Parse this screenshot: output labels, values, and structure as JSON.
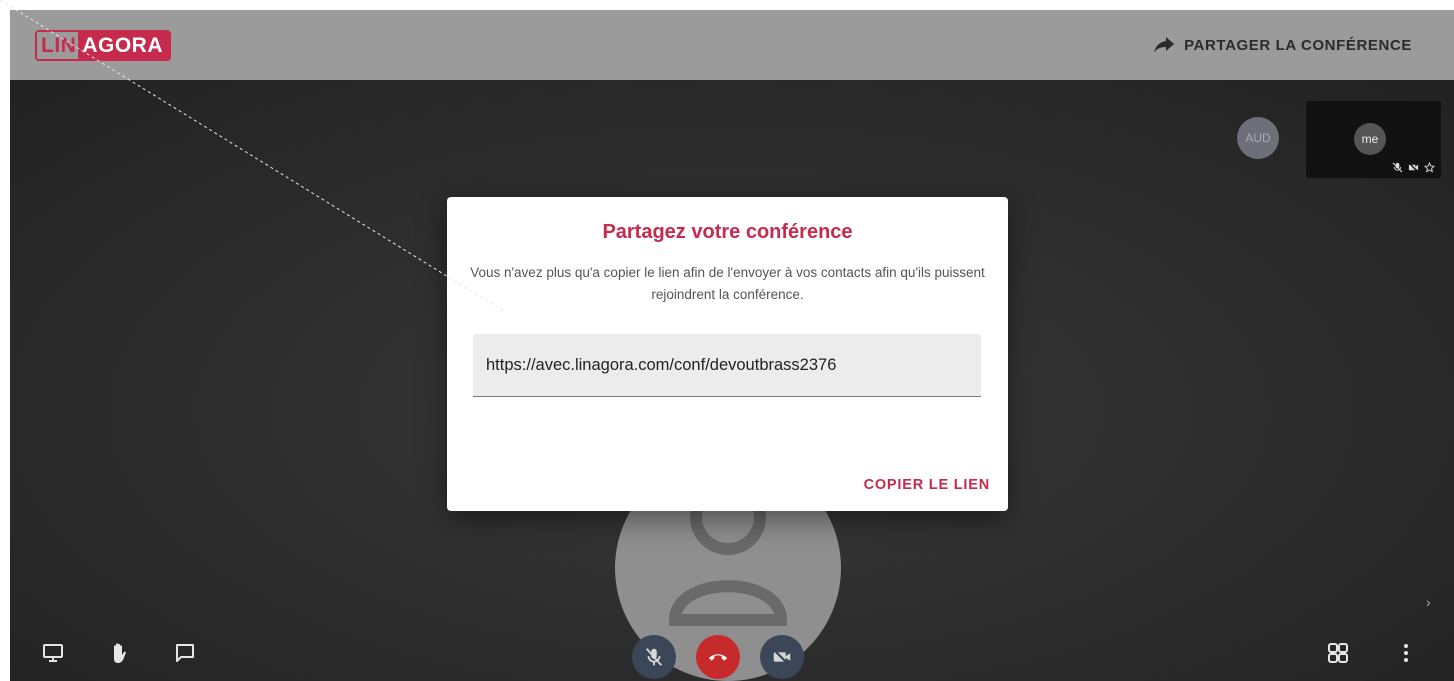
{
  "header": {
    "logo_part1": "LIN",
    "logo_part2": "AGORA",
    "share_label": "PARTAGER LA CONFÉRENCE"
  },
  "participants": {
    "aud_initials": "AUD",
    "me_label": "me"
  },
  "modal": {
    "title": "Partagez votre conférence",
    "description": "Vous n'avez plus qu'a copier le lien afin de l'envoyer à vos contacts afin qu'ils puissent rejoindrent la conférence.",
    "link_value": "https://avec.linagora.com/conf/devoutbrass2376",
    "copy_button": "COPIER LE LIEN"
  },
  "colors": {
    "brand": "#c62a4c",
    "header_bg": "#9b9b9b",
    "hangup": "#c62a2a",
    "stage_bg": "#262626"
  },
  "icons": [
    "share-arrow-icon",
    "screen-share-icon",
    "raise-hand-icon",
    "chat-icon",
    "mic-off-icon",
    "hangup-icon",
    "camera-off-icon",
    "grid-view-icon",
    "more-vertical-icon",
    "star-icon",
    "chevron-right-icon"
  ]
}
